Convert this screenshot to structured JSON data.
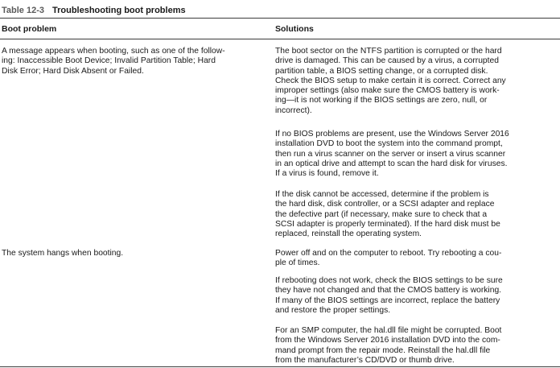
{
  "table": {
    "number": "Table 12-3",
    "title": "Troubleshooting boot problems",
    "headers": {
      "problem": "Boot problem",
      "solutions": "Solutions"
    },
    "rows": [
      {
        "problem_lines": [
          "A message appears when booting, such as one of the follow-",
          "ing: Inaccessible Boot Device; Invalid Partition Table; Hard",
          "Disk Error; Hard Disk Absent or Failed."
        ],
        "solutions": [
          {
            "lines": [
              "The boot sector on the NTFS partition is corrupted or the hard",
              "drive is damaged. This can be caused by a virus, a corrupted",
              "partition table, a BIOS setting change, or a corrupted disk.",
              "Check the BIOS setup to make certain it is correct. Correct any",
              "improper settings (also make sure the CMOS battery is work-",
              "ing—it is not working if the BIOS settings are zero, null, or",
              "incorrect)."
            ]
          },
          {
            "lines": [
              "If no BIOS problems are present, use the Windows Server 2016",
              "installation DVD to boot the system into the command prompt,",
              "then run a virus scanner on the server or insert a virus scanner",
              "in an optical drive and attempt to scan the hard disk for viruses.",
              "If a virus is found, remove it."
            ]
          },
          {
            "lines": [
              "If the disk cannot be accessed, determine if the problem is",
              "the hard disk, disk controller, or a SCSI adapter and replace",
              "the defective part (if necessary, make sure to check that a",
              "SCSI adapter is properly terminated). If the hard disk must be",
              "replaced, reinstall the operating system."
            ]
          }
        ]
      },
      {
        "problem_lines": [
          "The system hangs when booting."
        ],
        "solutions": [
          {
            "lines": [
              "Power off and on the computer to reboot. Try rebooting a cou-",
              "ple of times."
            ]
          },
          {
            "lines": [
              "If rebooting does not work, check the BIOS settings to be sure",
              "they have not changed and that the CMOS battery is working.",
              "If many of the BIOS settings are incorrect, replace the battery",
              "and restore the proper settings."
            ]
          },
          {
            "lines": [
              "For an SMP computer, the hal.dll file might be corrupted. Boot",
              "from the Windows Server 2016 installation DVD into the com-",
              "mand prompt from the repair mode. Reinstall the hal.dll file",
              "from the manufacturer’s CD/DVD or thumb drive."
            ]
          }
        ]
      }
    ]
  }
}
